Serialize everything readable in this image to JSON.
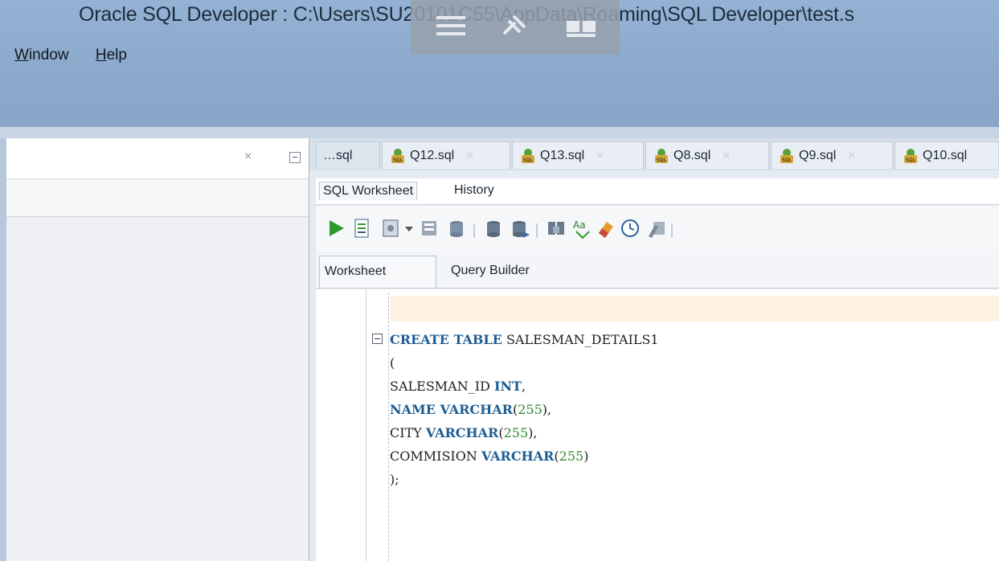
{
  "window": {
    "title": "Oracle SQL Developer : C:\\Users\\SU20101C55\\AppData\\Roaming\\SQL Developer\\test.s",
    "colors": {
      "titlebar": "#8ca9cc",
      "keyword": "#1e5d93",
      "number": "#2f8a2f",
      "current_line": "#fdf2e2"
    }
  },
  "menu": {
    "items": [
      "Window",
      "Help"
    ]
  },
  "left_panel": {
    "close_glyph": "×"
  },
  "editor_tabs": [
    {
      "label": "…sql"
    },
    {
      "label": "Q12.sql"
    },
    {
      "label": "Q13.sql"
    },
    {
      "label": "Q8.sql"
    },
    {
      "label": "Q9.sql"
    },
    {
      "label": "Q10.sql"
    }
  ],
  "sub_tabs": [
    "SQL Worksheet",
    "History"
  ],
  "worksheet_tabs": [
    "Worksheet",
    "Query Builder"
  ],
  "toolbar": {
    "icons": [
      "run-statement-icon",
      "run-script-icon",
      "autotrace-icon",
      "dropdown-arrow-icon",
      "explain-plan-icon",
      "sql-tuning-icon",
      "commit-icon",
      "rollback-icon",
      "unshared-sql-icon",
      "to-upper-icon",
      "clear-icon",
      "sql-history-icon",
      "find-db-object-icon"
    ]
  },
  "code": {
    "lines": [
      {
        "tokens": [
          {
            "t": "kw",
            "v": "CREATE TABLE"
          },
          {
            "t": "txt",
            "v": " SALESMAN_DETAILS1"
          }
        ]
      },
      {
        "tokens": [
          {
            "t": "txt",
            "v": "("
          }
        ]
      },
      {
        "tokens": [
          {
            "t": "txt",
            "v": "SALESMAN_ID "
          },
          {
            "t": "kw",
            "v": "INT"
          },
          {
            "t": "txt",
            "v": ","
          }
        ]
      },
      {
        "tokens": [
          {
            "t": "kw",
            "v": "NAME VARCHAR"
          },
          {
            "t": "txt",
            "v": "("
          },
          {
            "t": "num",
            "v": "255"
          },
          {
            "t": "txt",
            "v": "),"
          }
        ]
      },
      {
        "tokens": [
          {
            "t": "txt",
            "v": "CITY "
          },
          {
            "t": "kw",
            "v": "VARCHAR"
          },
          {
            "t": "txt",
            "v": "("
          },
          {
            "t": "num",
            "v": "255"
          },
          {
            "t": "txt",
            "v": "),"
          }
        ]
      },
      {
        "tokens": [
          {
            "t": "txt",
            "v": "COMMISION "
          },
          {
            "t": "kw",
            "v": "VARCHAR"
          },
          {
            "t": "txt",
            "v": "("
          },
          {
            "t": "num",
            "v": "255"
          },
          {
            "t": "txt",
            "v": ")"
          }
        ]
      },
      {
        "tokens": [
          {
            "t": "txt",
            "v": ");"
          }
        ]
      }
    ]
  }
}
